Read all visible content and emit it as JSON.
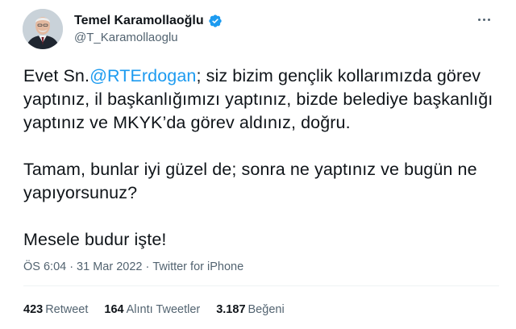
{
  "author": {
    "display_name": "Temel Karamollaoğlu",
    "handle": "@T_Karamollaoglu",
    "verified_icon": "verified-badge-icon",
    "more_icon": "more-options-icon"
  },
  "tweet": {
    "line1_prefix": "Evet Sn.",
    "mention": "@RTErdogan",
    "line1_rest": "; siz bizim gençlik kollarımızda görev yaptınız, il başkanlığımızı yaptınız, bizde belediye başkanlığı yaptınız ve MKYK’da görev aldınız, doğru.",
    "paragraph2": "Tamam, bunlar iyi güzel de; sonra ne yaptınız ve bugün ne yapıyorsunuz?",
    "paragraph3": "Mesele budur işte!"
  },
  "meta": {
    "time": "ÖS 6:04",
    "separator1": "·",
    "date": "31 Mar 2022",
    "separator2": "·",
    "source": "Twitter for iPhone"
  },
  "stats": {
    "retweets_count": "423",
    "retweets_label": "Retweet",
    "quotes_count": "164",
    "quotes_label": "Alıntı Tweetler",
    "likes_count": "3.187",
    "likes_label": "Beğeni"
  },
  "colors": {
    "link": "#1d9bf0",
    "secondary_text": "#536471",
    "primary_text": "#0f1419",
    "divider": "#eff3f4"
  }
}
